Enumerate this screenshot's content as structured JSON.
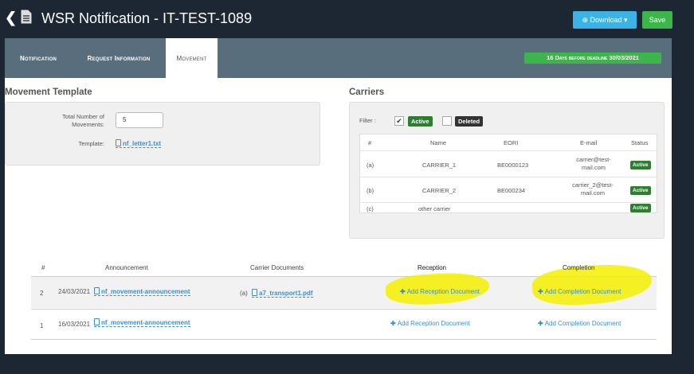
{
  "header": {
    "title": "WSR Notification - IT-TEST-1089",
    "download_label": "⊕ Download ▾",
    "save_label": "Save"
  },
  "tabs": [
    "Notification",
    "Request Information",
    "Movement"
  ],
  "active_tab": "Movement",
  "deadline_badge": "16 Days before deadline 30/03/2021",
  "movement_template": {
    "title": "Movement Template",
    "total_label": "Total Number of Movements:",
    "total_value": "5",
    "template_label": "Template:",
    "template_file": "nf_letter1.txt"
  },
  "carriers": {
    "title": "Carriers",
    "filter_label": "Filter :",
    "active_checked": "✔",
    "active_label": "Active",
    "deleted_label": "Deleted",
    "columns": [
      "#",
      "Name",
      "EORI",
      "E-mail",
      "Status"
    ],
    "rows": [
      {
        "idx": "(a)",
        "name": "CARRIER_1",
        "eori": "BE0000123",
        "email1": "carrier@test-",
        "email2": "mail.com",
        "status": "Active"
      },
      {
        "idx": "(b)",
        "name": "CARRIER_2",
        "eori": "BE000234",
        "email1": "carrier_2@test-",
        "email2": "mail.com",
        "status": "Active"
      },
      {
        "idx": "(c)",
        "name": "other carrier",
        "eori": "",
        "email1": "",
        "email2": "",
        "status": "Active"
      }
    ]
  },
  "movements": {
    "columns": [
      "#",
      "Announcement",
      "Carrier Documents",
      "Reception",
      "Completion"
    ],
    "rows": [
      {
        "num": "2",
        "date": "24/03/2021",
        "announcement": "nf_movement-announcement",
        "carrier_prefix": "(a)",
        "carrier_doc": "a7_transport1.pdf",
        "reception": "Add Reception Document",
        "completion": "Add Completion Document"
      },
      {
        "num": "1",
        "date": "16/03/2021",
        "announcement": "nf_movement-announcement",
        "carrier_prefix": "",
        "carrier_doc": "",
        "reception": "Add Reception Document",
        "completion": "Add Completion Document"
      }
    ]
  },
  "colors": {
    "accent_blue": "#3bb4e5",
    "green": "#3cb54a",
    "dark_green": "#2e7d32",
    "highlight": "#f4f000"
  }
}
